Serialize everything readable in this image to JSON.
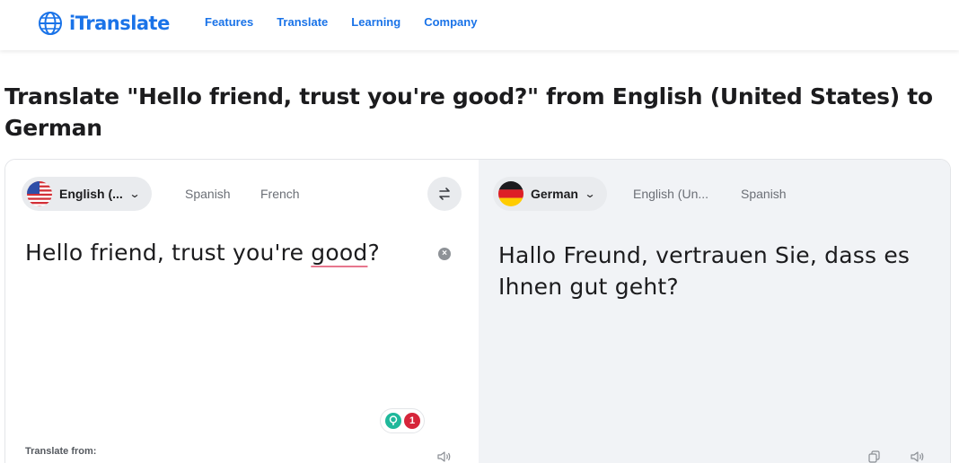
{
  "brand": {
    "name": "iTranslate",
    "color": "#1a73e8"
  },
  "nav": [
    "Features",
    "Translate",
    "Learning",
    "Company"
  ],
  "heading": "Translate \"Hello friend, trust you're good?\" from English (United States) to German",
  "source": {
    "selected_language": "English (...",
    "alternatives": [
      "Spanish",
      "French"
    ],
    "text_before": "Hello friend, trust you're ",
    "text_flagged": "good",
    "text_after": "?",
    "grammar_issues": "1",
    "footer_label": "Translate from:"
  },
  "target": {
    "selected_language": "German",
    "alternatives": [
      "English (Un...",
      "Spanish"
    ],
    "text": "Hallo Freund, vertrauen Sie, dass es Ihnen gut geht?"
  },
  "icons": {
    "swap": "swap-icon",
    "clear": "clear-icon",
    "speaker": "speaker-icon",
    "copy": "copy-icon",
    "bulb": "bulb-icon"
  }
}
